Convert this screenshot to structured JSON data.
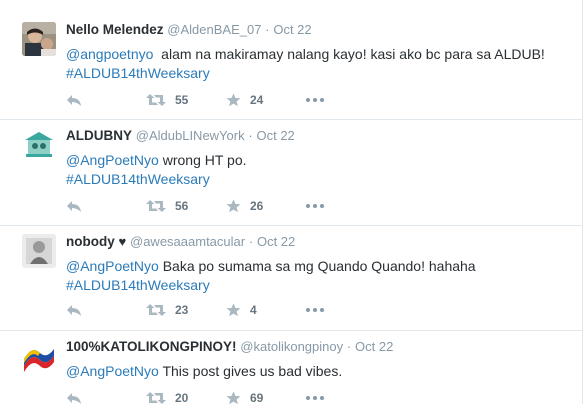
{
  "colors": {
    "link": "#2b7bb9",
    "muted": "#8899a6",
    "icon": "#aab8c2",
    "divider": "#e1e8ed"
  },
  "tweets": [
    {
      "name": "Nello Melendez",
      "handle": "@AldenBAE_07",
      "separator": "·",
      "time": "Oct 22",
      "mention": "@angpoetnyo",
      "text": "  alam na makiramay nalang kayo! kasi ako bc para sa ALDUB!",
      "hashtag": "#ALDUB14thWeeksary",
      "retweets": "55",
      "favorites": "24",
      "avatar_icon": "profile-photo"
    },
    {
      "name": "ALDUBNY",
      "handle": "@AldubLINewYork",
      "separator": "·",
      "time": "Oct 22",
      "mention": "@AngPoetNyo",
      "text": " wrong HT po.",
      "hashtag": "#ALDUB14thWeeksary",
      "retweets": "56",
      "favorites": "26",
      "avatar_icon": "aldubny-logo"
    },
    {
      "name": "nobody",
      "name_suffix": "♥",
      "handle": "@awesaaamtacular",
      "separator": "·",
      "time": "Oct 22",
      "mention": "@AngPoetNyo",
      "text": " Baka po sumama sa mg Quando Quando! hahaha",
      "hashtag": "#ALDUB14thWeeksary",
      "retweets": "23",
      "favorites": "4",
      "avatar_icon": "profile-photo"
    },
    {
      "name": "100%KATOLIKONGPINOY!",
      "handle": "@katolikongpinoy",
      "separator": "·",
      "time": "Oct 22",
      "mention": "@AngPoetNyo",
      "text": " This post gives us bad vibes.",
      "retweets": "20",
      "favorites": "69",
      "avatar_icon": "flag-logo"
    }
  ]
}
